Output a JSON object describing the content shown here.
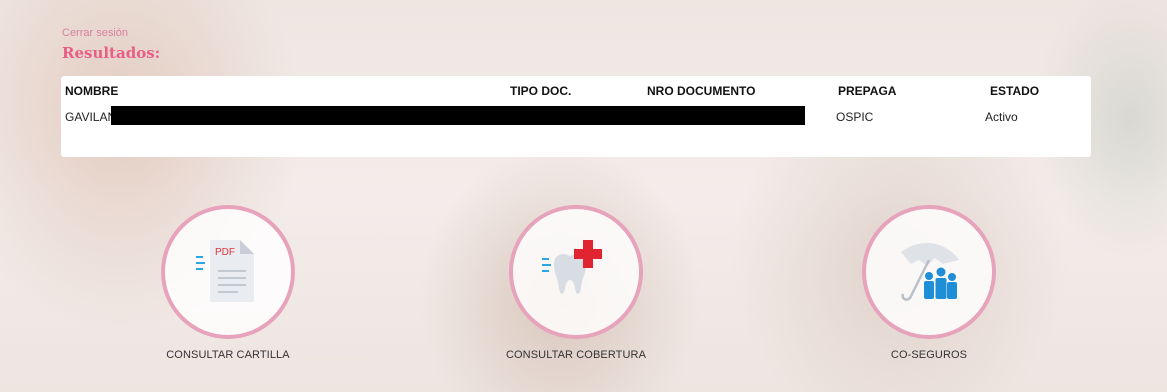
{
  "header": {
    "logout_label": "Cerrar sesión",
    "title": "Resultados:"
  },
  "table": {
    "columns": [
      "NOMBRE",
      "TIPO DOC.",
      "NRO DOCUMENTO",
      "PREPAGA",
      "ESTADO"
    ],
    "rows": [
      {
        "nombre": "GAVILAN",
        "tipo_doc": "",
        "nro_documento": "",
        "prepaga": "OSPIC",
        "estado": "Activo"
      }
    ]
  },
  "actions": [
    {
      "label": "CONSULTAR CARTILLA",
      "icon": "pdf-document-icon"
    },
    {
      "label": "CONSULTAR COBERTURA",
      "icon": "tooth-cross-icon"
    },
    {
      "label": "CO-SEGUROS",
      "icon": "umbrella-family-icon"
    }
  ],
  "colors": {
    "accent": "#e85e86",
    "circle_border": "#e6a3bb",
    "red_cross": "#e02430",
    "family_blue": "#1e8fd6"
  }
}
